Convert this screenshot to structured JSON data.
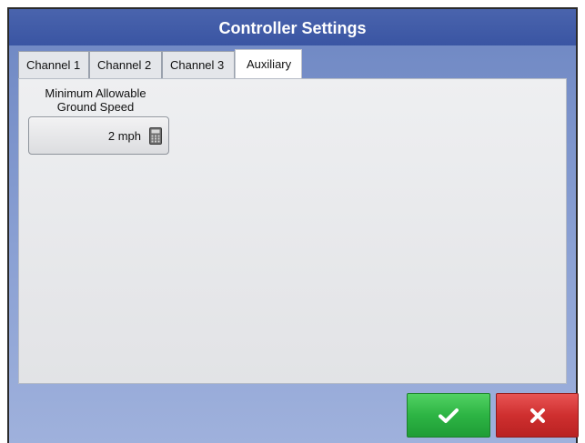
{
  "window": {
    "title": "Controller Settings"
  },
  "tabs": [
    {
      "label": "Channel 1",
      "active": false
    },
    {
      "label": "Channel 2",
      "active": false
    },
    {
      "label": "Channel 3",
      "active": false
    },
    {
      "label": "Auxiliary",
      "active": true
    }
  ],
  "auxiliary": {
    "field_label_line1": "Minimum Allowable",
    "field_label_line2": "Ground Speed",
    "value": "2 mph",
    "value_icon": "calculator-icon"
  },
  "buttons": {
    "ok_icon": "checkmark-icon",
    "cancel_icon": "x-icon"
  },
  "colors": {
    "title_bar": "#3f5aa8",
    "ok_green": "#2db444",
    "cancel_red": "#cf2f2f"
  }
}
